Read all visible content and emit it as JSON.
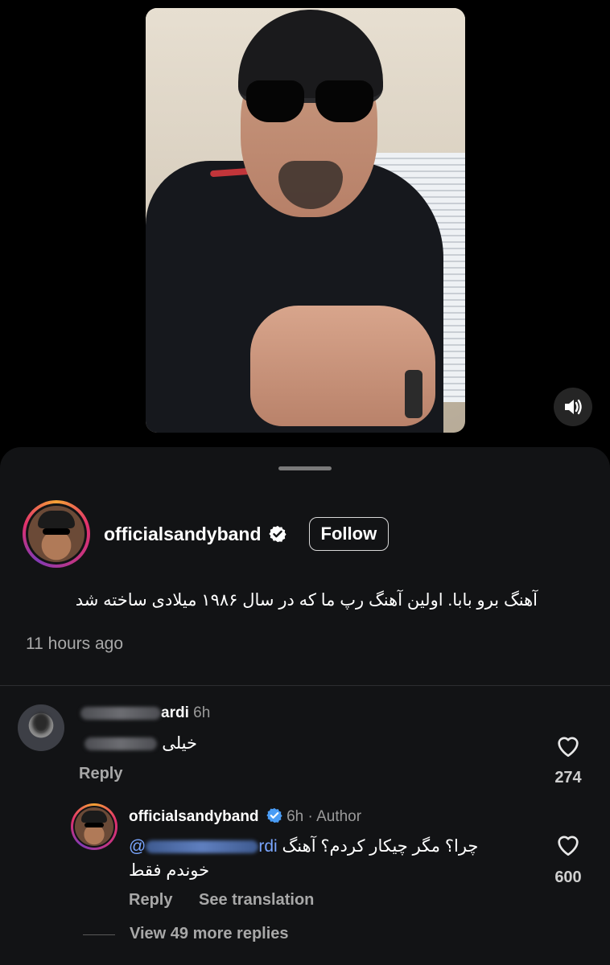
{
  "post": {
    "author": "officialsandyband",
    "follow_label": "Follow",
    "caption": "آهنگ برو بابا. اولین آهنگ رپ ما که در سال ۱۹۸۶ میلادی ساخته شد",
    "time": "11 hours ago"
  },
  "comments": [
    {
      "username_visible": "ardi",
      "time": "6h",
      "text_visible": "خیلی",
      "reply_label": "Reply",
      "likes": "274"
    }
  ],
  "reply": {
    "username": "officialsandyband",
    "time": "6h",
    "author_tag": "Author",
    "mention_start": "@",
    "mention_end": "rdi",
    "text_line1": "چرا؟ مگر چیکار کردم؟ آهنگ",
    "text_line2": "خوندم فقط",
    "reply_label": "Reply",
    "translate_label": "See translation",
    "likes": "600"
  },
  "view_more": "View 49 more replies",
  "icons": {
    "sound": "speaker-icon",
    "verified": "verified-badge-icon",
    "like": "heart-icon"
  },
  "colors": {
    "background": "#000000",
    "sheet": "#121315",
    "mention": "#7aa6ff",
    "verified": "#ffffff"
  }
}
